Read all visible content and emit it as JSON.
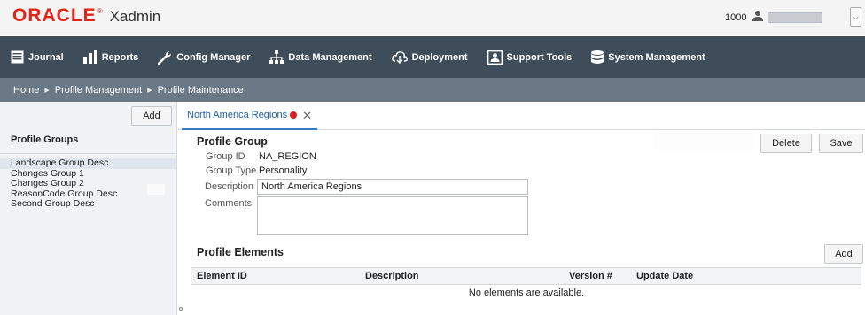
{
  "header": {
    "brand": "ORACLE",
    "brand_mark": "®",
    "app_name": "Xadmin",
    "store_number": "1000",
    "user_dropdown_icon": "chevron-down-icon"
  },
  "nav": {
    "items": [
      {
        "label": "Journal",
        "icon": "journal-icon"
      },
      {
        "label": "Reports",
        "icon": "bar-chart-icon"
      },
      {
        "label": "Config Manager",
        "icon": "wrench-icon"
      },
      {
        "label": "Data Management",
        "icon": "hierarchy-icon"
      },
      {
        "label": "Deployment",
        "icon": "cloud-download-icon"
      },
      {
        "label": "Support Tools",
        "icon": "support-person-icon"
      },
      {
        "label": "System Management",
        "icon": "database-icon"
      }
    ]
  },
  "breadcrumb": {
    "items": [
      "Home",
      "Profile Management",
      "Profile Maintenance"
    ]
  },
  "left_panel": {
    "add_label": "Add",
    "title": "Profile Groups",
    "groups": [
      {
        "label": "Landscape Group Desc",
        "selected": true
      },
      {
        "label": "Changes Group 1",
        "selected": false
      },
      {
        "label": "Changes Group 2",
        "selected": false
      },
      {
        "label": "ReasonCode Group Desc",
        "selected": false
      },
      {
        "label": "Second Group Desc",
        "selected": false
      }
    ]
  },
  "tab": {
    "label": "North America Regions",
    "close": "✕"
  },
  "profile_group": {
    "title": "Profile Group",
    "delete_label": "Delete",
    "save_label": "Save",
    "group_id_label": "Group ID",
    "group_id_value": "NA_REGION",
    "group_type_label": "Group Type",
    "group_type_value": "Personality",
    "description_label": "Description",
    "description_value": "North America Regions",
    "comments_label": "Comments",
    "comments_value": ""
  },
  "profile_elements": {
    "title": "Profile Elements",
    "add_label": "Add",
    "columns": [
      "Element ID",
      "Description",
      "Version #",
      "Update Date"
    ],
    "empty_text": "No elements are available."
  },
  "colors": {
    "brand_red": "#e2231a",
    "nav_bg": "#3f4d5a",
    "breadcrumb_bg": "#6b7986",
    "tab_accent": "#3978c5"
  }
}
